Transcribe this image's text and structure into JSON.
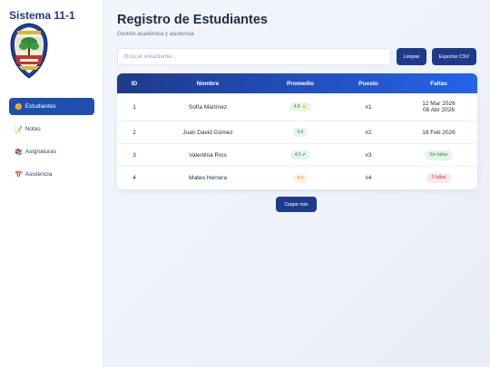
{
  "sidebar": {
    "brand": "Sistema 11-1",
    "items": [
      {
        "icon": "🌞",
        "label": "Estudiantes"
      },
      {
        "icon": "📝",
        "label": "Notas"
      },
      {
        "icon": "📚",
        "label": "Asignaturas"
      },
      {
        "icon": "📅",
        "label": "Asistencia"
      }
    ]
  },
  "header": {
    "title": "Registro de Estudiantes",
    "subtitle": "Gestión académica y asistencia."
  },
  "search": {
    "placeholder": "Buscar estudiante...",
    "value": ""
  },
  "toolbar": {
    "clear_label": "Limpiar",
    "export_label": "Exportar CSV"
  },
  "table": {
    "columns": [
      "ID",
      "Nombre",
      "Promedio",
      "Puesto",
      "Faltas"
    ],
    "rows": [
      {
        "id": "1",
        "name": "Sofía Martínez",
        "avg": "4.8 ⭐",
        "avg_status": "green",
        "pos": "#1",
        "faltas1": "12 Mar 2026",
        "faltas2": "08 Abr 2026"
      },
      {
        "id": "2",
        "name": "Juan David Gómez",
        "avg": "4.6",
        "avg_status": "green",
        "pos": "#2",
        "faltas1": "18 Feb 2026"
      },
      {
        "id": "3",
        "name": "Valentina Ríos",
        "avg": "4.5 ✔",
        "avg_status": "green",
        "pos": "#3",
        "faltas_badge": "Sin faltas",
        "faltas_status": "green"
      },
      {
        "id": "4",
        "name": "Mateo Herrera",
        "avg": "4.2",
        "avg_status": "orange",
        "pos": "#4",
        "faltas_badge": "3 faltas",
        "faltas_status": "red"
      }
    ]
  },
  "load_more_label": "Cargar más",
  "colors": {
    "primary": "#1e3a8a",
    "accent": "#2563eb",
    "ok": "#2f8f55",
    "warn": "#e08a1e",
    "bad": "#d03a4a"
  }
}
